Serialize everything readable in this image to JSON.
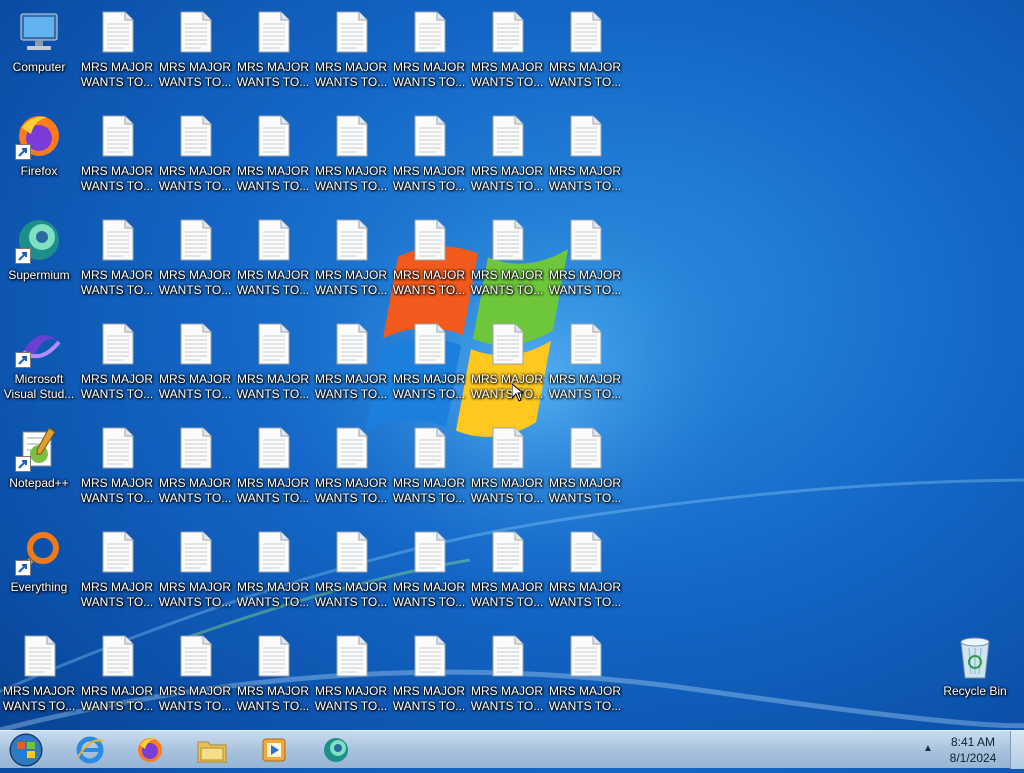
{
  "desktop": {
    "system_icons": [
      {
        "name": "computer-icon",
        "label": "Computer"
      },
      {
        "name": "firefox-icon",
        "label": "Firefox"
      },
      {
        "name": "supermium-icon",
        "label": "Supermium"
      },
      {
        "name": "visual-studio-icon",
        "label": "Microsoft\nVisual Stud..."
      },
      {
        "name": "notepad-plus-plus-icon",
        "label": "Notepad++"
      },
      {
        "name": "everything-icon",
        "label": "Everything"
      }
    ],
    "file_label": "MRS MAJOR\nWANTS TO...",
    "file_icon": "text-document-icon",
    "file_rows": 7,
    "file_cols": 7,
    "recycle_bin": {
      "label": "Recycle Bin",
      "icon": "recycle-bin-icon"
    }
  },
  "taskbar": {
    "start_icon": "windows-start-orb-icon",
    "pinned": [
      {
        "name": "internet-explorer-icon"
      },
      {
        "name": "firefox-icon"
      },
      {
        "name": "file-explorer-icon"
      },
      {
        "name": "media-player-icon"
      },
      {
        "name": "supermium-icon"
      }
    ],
    "tray_arrow": "▲",
    "time": "8:41 AM",
    "date": "8/1/2024"
  },
  "colors": {
    "desktop_bg": "#1466c6",
    "taskbar": "#a9c3df"
  }
}
